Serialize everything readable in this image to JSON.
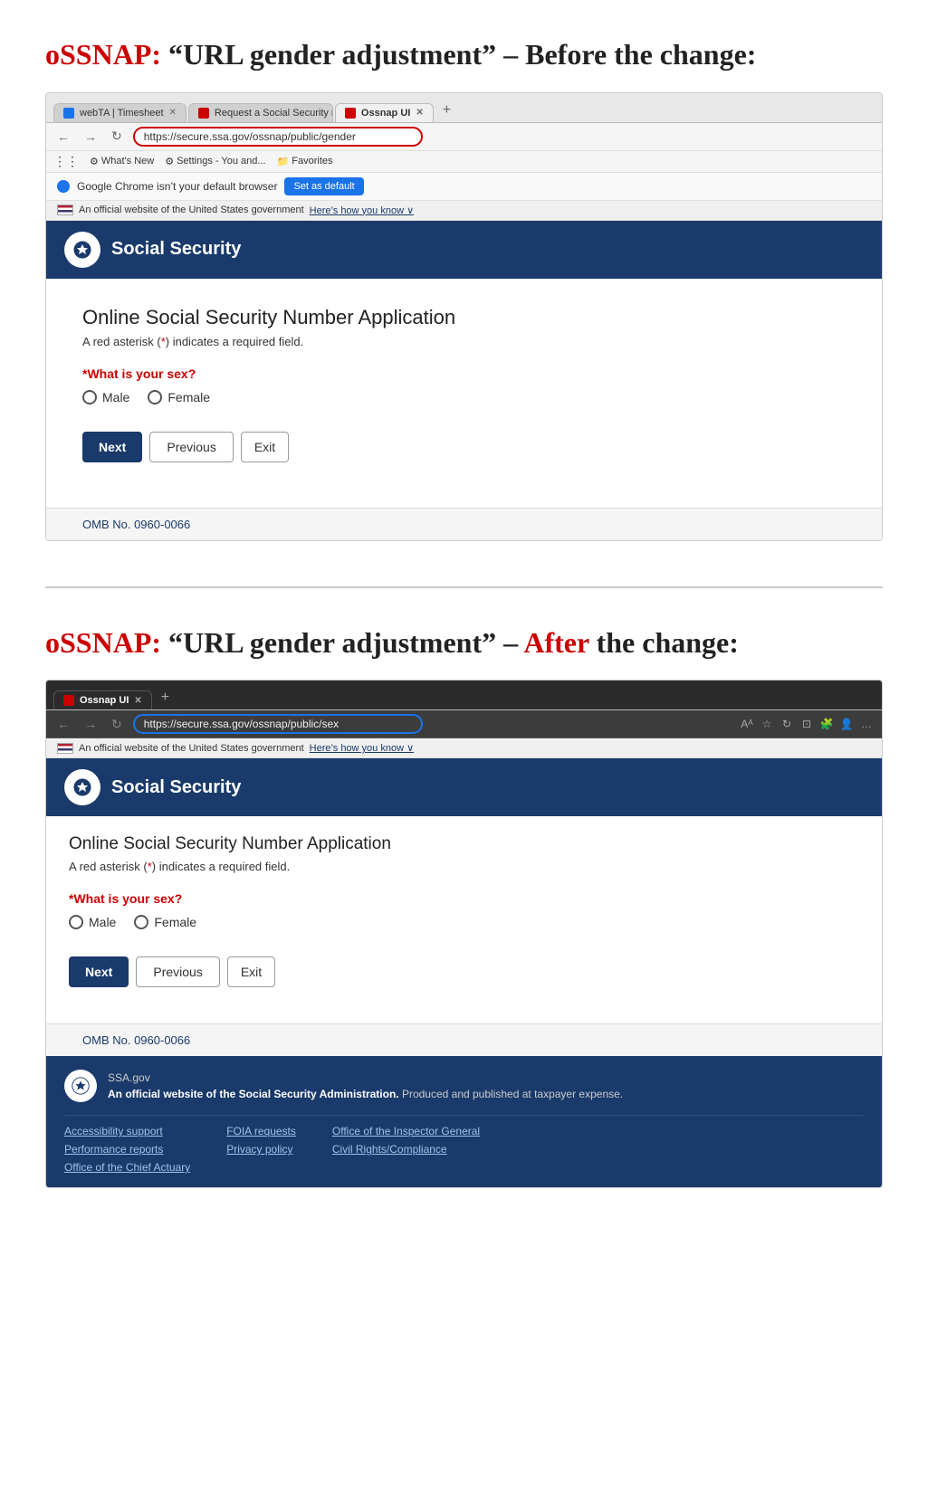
{
  "page": {
    "heading_before": "oSSNAP: “URL gender adjustment” – Before the change:",
    "heading_after": "oSSNAP: “URL gender adjustment” – After the change:",
    "heading_before_label_osssnap": "oSSNAP:",
    "heading_before_label_rest": "“URL gender adjustment” – Before the change:",
    "heading_after_label_osssnap": "oSSNAP:",
    "heading_after_label_middle": "“URL gender adjustment” –",
    "heading_after_label_after": "After",
    "heading_after_label_end": "the change:"
  },
  "browser_before": {
    "tabs": [
      {
        "label": "webTA | Timesheet",
        "active": false,
        "favicon": "blue"
      },
      {
        "label": "Request a Social Security num...",
        "active": false,
        "favicon": "red"
      },
      {
        "label": "Ossnap UI",
        "active": true,
        "favicon": "red"
      }
    ],
    "url": "https://secure.ssa.gov/ossnap/public/gender",
    "bookmarks": [
      "What's New",
      "Settings - You and...",
      "Favorites"
    ],
    "notification": "Google Chrome isn’t your default browser",
    "notification_btn": "Set as default",
    "gov_banner": "An official website of the United States government",
    "gov_banner_link": "Here’s how you know ∨"
  },
  "browser_after": {
    "tabs": [
      {
        "label": "Ossnap UI",
        "active": true,
        "favicon": "red"
      }
    ],
    "url": "https://secure.ssa.gov/ossnap/public/sex",
    "gov_banner": "An official website of the United States government",
    "gov_banner_link": "Here’s how you know ∨"
  },
  "ssa_form": {
    "header_title": "Social Security",
    "page_title": "Online Social Security Number Application",
    "required_note": "A red asterisk (*) indicates a required field.",
    "required_asterisk": "*",
    "question_label": "What is your sex?",
    "question_asterisk": "*",
    "options": [
      "Male",
      "Female"
    ],
    "btn_next": "Next",
    "btn_previous": "Previous",
    "btn_exit": "Exit",
    "omb_label": "OMB No. 0960-0066"
  },
  "ssa_footer": {
    "ssagov_label": "SSA.gov",
    "official_text_bold": "An official website of the Social Security Administration.",
    "official_text_rest": " Produced and published at taxpayer expense.",
    "links_col1": [
      "Accessibility support",
      "Performance reports",
      "Office of the Chief Actuary"
    ],
    "links_col2": [
      "FOIA requests",
      "Privacy policy"
    ],
    "links_col3": [
      "Office of the Inspector General",
      "Civil Rights/Compliance"
    ]
  }
}
